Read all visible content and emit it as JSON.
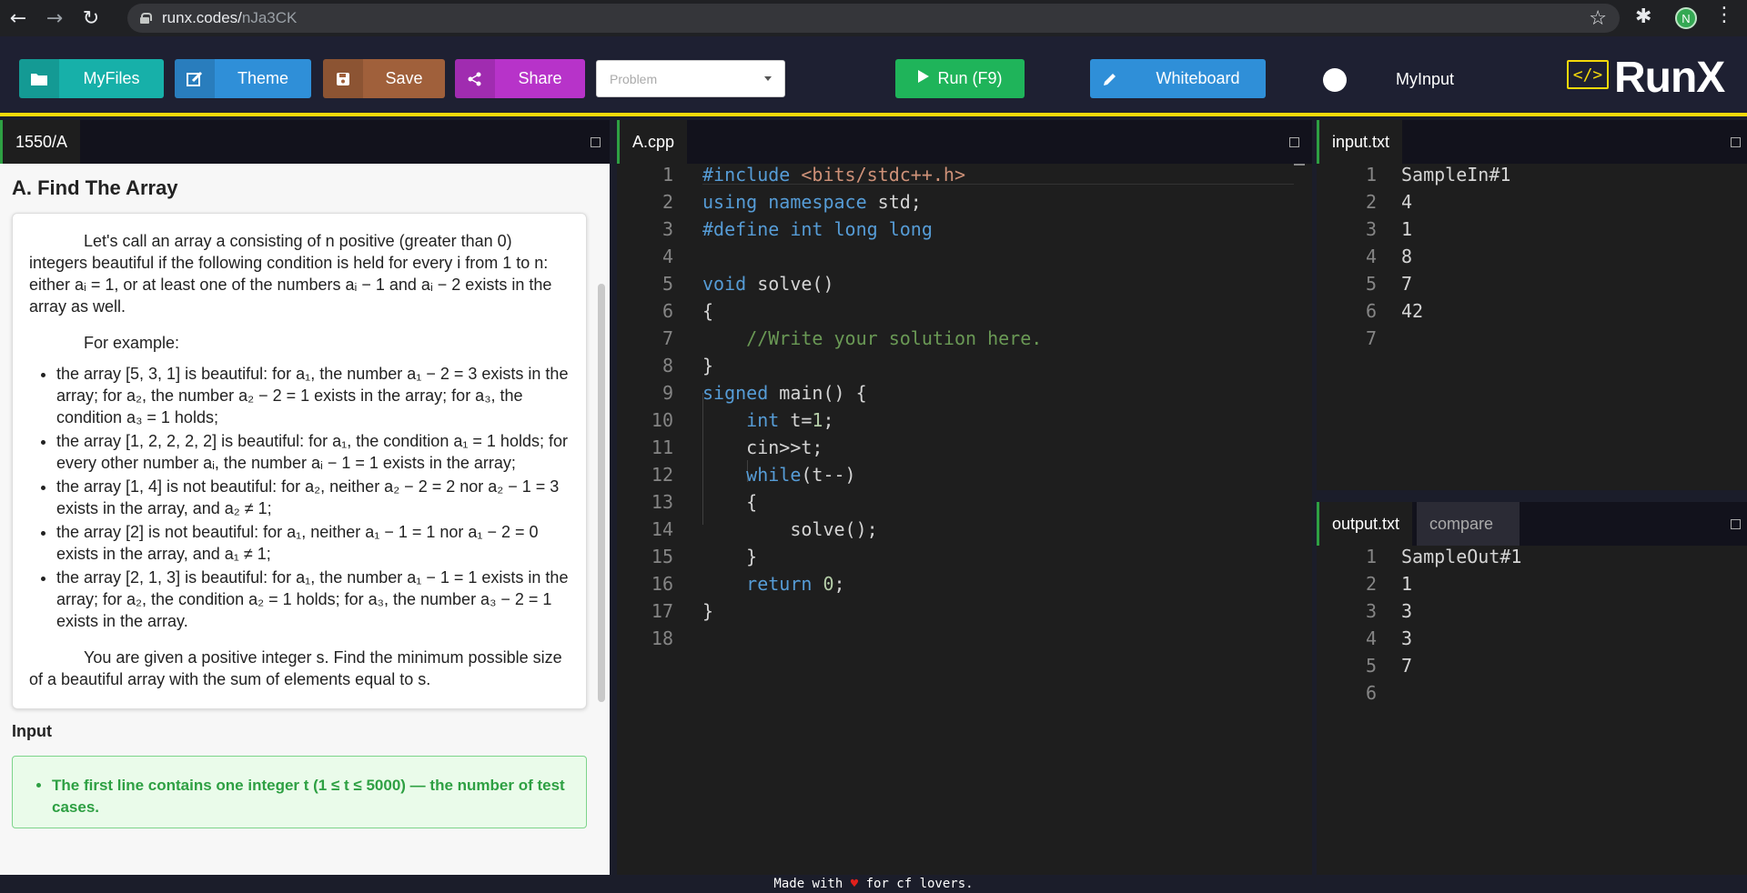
{
  "browser": {
    "url_host": "runx.codes/",
    "url_path": "nJa3CK",
    "profile_initial": "N"
  },
  "toolbar": {
    "myfiles_label": "MyFiles",
    "theme_label": "Theme",
    "save_label": "Save",
    "share_label": "Share",
    "problem_placeholder": "Problem",
    "run_label": "Run (F9)",
    "whiteboard_label": "Whiteboard",
    "myinput_label": "MyInput",
    "logo_text": "RunX",
    "logo_icon": "</>"
  },
  "colors": {
    "myfiles": "#17b0a9",
    "theme": "#2f8fd8",
    "save": "#a0603b",
    "share": "#b733c9",
    "run": "#1fb45a",
    "whiteboard": "#2f8fd8",
    "accent": "#f5d90a"
  },
  "problem_panel": {
    "tab": "1550/A",
    "title": "A. Find The Array",
    "intro": "Let's call an array a consisting of n positive (greater than 0) integers beautiful if the following condition is held for every i from 1 to n: either aᵢ = 1, or at least one of the numbers aᵢ − 1 and aᵢ − 2 exists in the array as well.",
    "example_label": "For example:",
    "examples": [
      "the array [5, 3, 1] is beautiful: for a₁, the number a₁ − 2 = 3 exists in the array; for a₂, the number a₂ − 2 = 1 exists in the array; for a₃, the condition a₃ = 1 holds;",
      "the array [1, 2, 2, 2, 2] is beautiful: for a₁, the condition a₁ = 1 holds; for every other number aᵢ, the number aᵢ − 1 = 1 exists in the array;",
      "the array [1, 4] is not beautiful: for a₂, neither a₂ − 2 = 2 nor a₂ − 1 = 3 exists in the array, and a₂ ≠ 1;",
      "the array [2] is not beautiful: for a₁, neither a₁ − 1 = 1 nor a₁ − 2 = 0 exists in the array, and a₁ ≠ 1;",
      "the array [2, 1, 3] is beautiful: for a₁, the number a₁ − 1 = 1 exists in the array; for a₂, the condition a₂ = 1 holds; for a₃, the number a₃ − 2 = 1 exists in the array."
    ],
    "task": "You are given a positive integer s. Find the minimum possible size of a beautiful array with the sum of elements equal to s.",
    "input_heading": "Input",
    "input_first": "The first line contains one integer t (1 ≤ t ≤ 5000) — the number of test cases."
  },
  "editor": {
    "tab": "A.cpp",
    "line_numbers": [
      "1",
      "2",
      "3",
      "4",
      "5",
      "6",
      "7",
      "8",
      "9",
      "10",
      "11",
      "12",
      "13",
      "14",
      "15",
      "16",
      "17",
      "18"
    ]
  },
  "input_panel": {
    "tab": "input.txt",
    "line_numbers": [
      "1",
      "2",
      "3",
      "4",
      "5",
      "6",
      "7"
    ],
    "lines": [
      "SampleIn#1",
      "4",
      "1",
      "8",
      "7",
      "42",
      ""
    ]
  },
  "output_panel": {
    "tab": "output.txt",
    "compare_tab": "compare",
    "line_numbers": [
      "1",
      "2",
      "3",
      "4",
      "5",
      "6"
    ],
    "lines": [
      "SampleOut#1",
      "1",
      "3",
      "3",
      "7",
      ""
    ]
  },
  "footer": {
    "before": "Made with ",
    "heart": "♥",
    "after": " for cf lovers."
  }
}
